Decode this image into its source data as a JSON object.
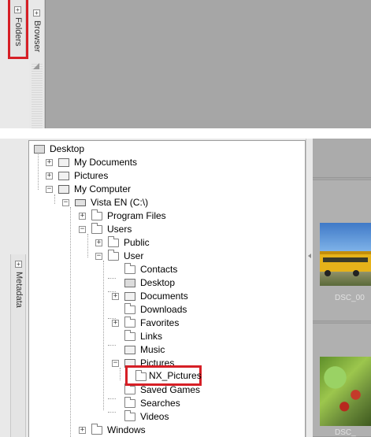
{
  "top_panel": {
    "folders_tab_label": "Folders",
    "browser_tab_label": "Browser",
    "expand_symbol": "+"
  },
  "bottom_panel": {
    "metadata_tab_label": "Metadata",
    "tree": {
      "items": [
        {
          "label": "Desktop",
          "icon": "desktop-icon",
          "expander": ""
        },
        {
          "label": "My Documents",
          "icon": "documents-folder-icon",
          "expander": "+"
        },
        {
          "label": "Pictures",
          "icon": "pictures-folder-icon",
          "expander": "+"
        },
        {
          "label": "My Computer",
          "icon": "computer-icon",
          "expander": "−"
        },
        {
          "label": "Vista EN (C:\\)",
          "icon": "drive-icon",
          "expander": "−"
        },
        {
          "label": "Program Files",
          "icon": "folder-icon",
          "expander": "+"
        },
        {
          "label": "Users",
          "icon": "folder-icon",
          "expander": "−"
        },
        {
          "label": "Public",
          "icon": "folder-icon",
          "expander": "+"
        },
        {
          "label": "User",
          "icon": "folder-icon",
          "expander": "−"
        },
        {
          "label": "Contacts",
          "icon": "folder-icon",
          "expander": ""
        },
        {
          "label": "Desktop",
          "icon": "desktop-icon",
          "expander": ""
        },
        {
          "label": "Documents",
          "icon": "documents-folder-icon",
          "expander": "+"
        },
        {
          "label": "Downloads",
          "icon": "folder-icon",
          "expander": ""
        },
        {
          "label": "Favorites",
          "icon": "folder-icon",
          "expander": "+"
        },
        {
          "label": "Links",
          "icon": "folder-icon",
          "expander": ""
        },
        {
          "label": "Music",
          "icon": "music-folder-icon",
          "expander": ""
        },
        {
          "label": "Pictures",
          "icon": "pictures-folder-icon",
          "expander": "−"
        },
        {
          "label": "NX_Pictures",
          "icon": "folder-icon",
          "expander": ""
        },
        {
          "label": "Saved Games",
          "icon": "folder-icon",
          "expander": ""
        },
        {
          "label": "Searches",
          "icon": "folder-icon",
          "expander": ""
        },
        {
          "label": "Videos",
          "icon": "folder-icon",
          "expander": ""
        },
        {
          "label": "Windows",
          "icon": "folder-icon",
          "expander": "+"
        }
      ]
    },
    "thumbnails": [
      {
        "caption": "DSC_00"
      },
      {
        "caption": "DSC_"
      }
    ]
  },
  "colors": {
    "highlight": "#d61f26",
    "content_gray": "#a6a6a6"
  }
}
